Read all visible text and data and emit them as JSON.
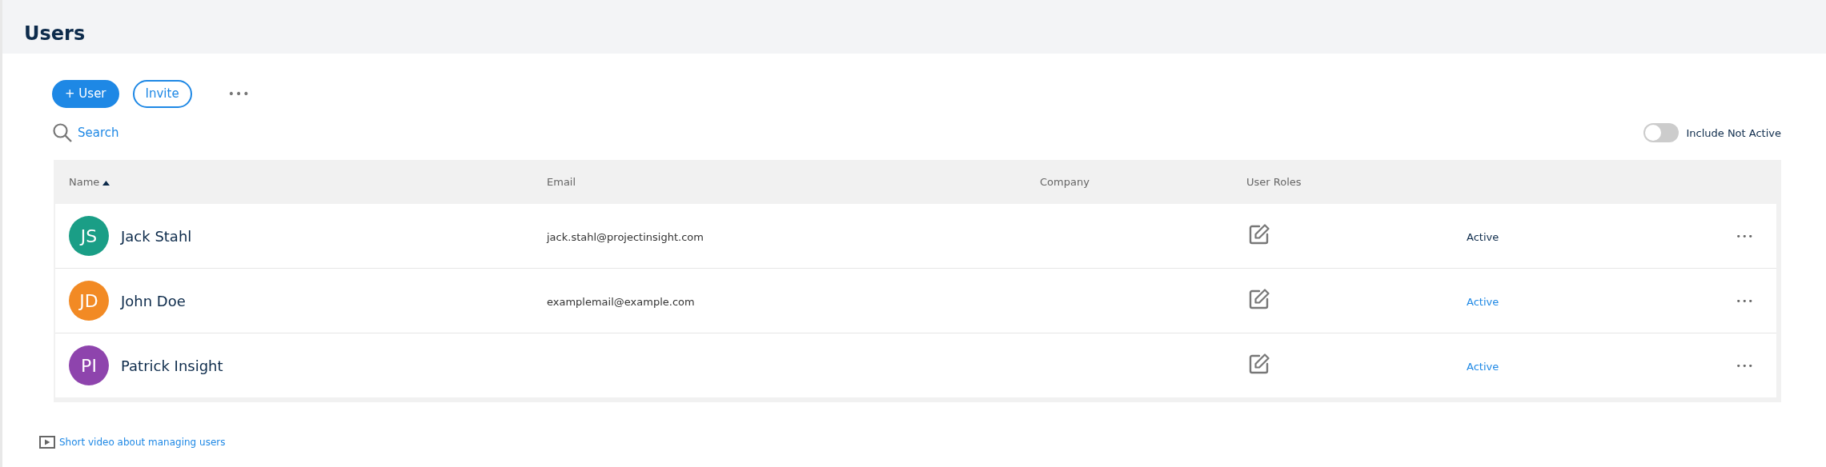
{
  "page": {
    "title": "Users"
  },
  "toolbar": {
    "buttons": [
      {
        "label": "+ User",
        "kind": "primary"
      },
      {
        "label": "Invite",
        "kind": "outline"
      }
    ],
    "more": "•••"
  },
  "search": {
    "placeholder": "Search"
  },
  "include_not_active": {
    "label": "Include Not Active",
    "on": false
  },
  "table": {
    "columns": [
      {
        "label": "Name",
        "sorted": true
      },
      {
        "label": "Email",
        "sorted": false
      },
      {
        "label": "Company",
        "sorted": false
      },
      {
        "label": "User Roles",
        "sorted": false
      }
    ],
    "rows": [
      {
        "initials": "JS",
        "color": "#1a9e86",
        "name": "Jack Stahl",
        "email": "jack.stahl@projectinsight.com",
        "status": "Active",
        "status_link": false,
        "more": "•••"
      },
      {
        "initials": "JD",
        "color": "#f28a24",
        "name": "John Doe",
        "email": "examplemail@example.com",
        "status": "Active",
        "status_link": true,
        "more": "•••"
      },
      {
        "initials": "PI",
        "color": "#8e44ad",
        "name": "Patrick Insight",
        "email": "",
        "status": "Active",
        "status_link": true,
        "more": "•••"
      }
    ]
  },
  "footer_link": "Short video about managing users"
}
